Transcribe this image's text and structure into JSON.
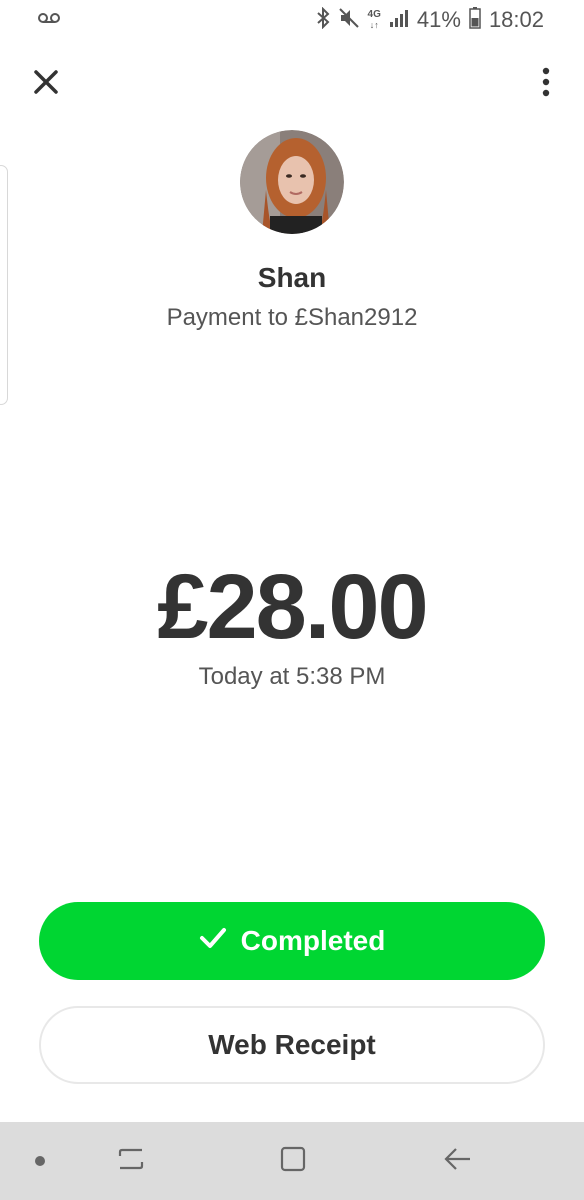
{
  "status_bar": {
    "network": "4G",
    "battery_percent": "41%",
    "time": "18:02",
    "icons": [
      "voicemail-icon",
      "bluetooth-icon",
      "mute-icon",
      "signal-icon",
      "battery-icon"
    ]
  },
  "header": {
    "close_icon": "close-icon",
    "more_icon": "more-vertical-icon"
  },
  "recipient": {
    "name": "Shan",
    "subtitle": "Payment to £Shan2912"
  },
  "payment": {
    "amount": "£28.00",
    "date": "Today at 5:38 PM"
  },
  "actions": {
    "completed_label": "Completed",
    "web_receipt_label": "Web Receipt"
  },
  "nav_bar": {
    "icons": [
      "dot-icon",
      "recent-apps-icon",
      "home-icon",
      "back-icon"
    ]
  },
  "colors": {
    "accent": "#00d632",
    "text_primary": "#333333",
    "text_secondary": "#555555",
    "nav_bar": "#dcdcdc"
  }
}
